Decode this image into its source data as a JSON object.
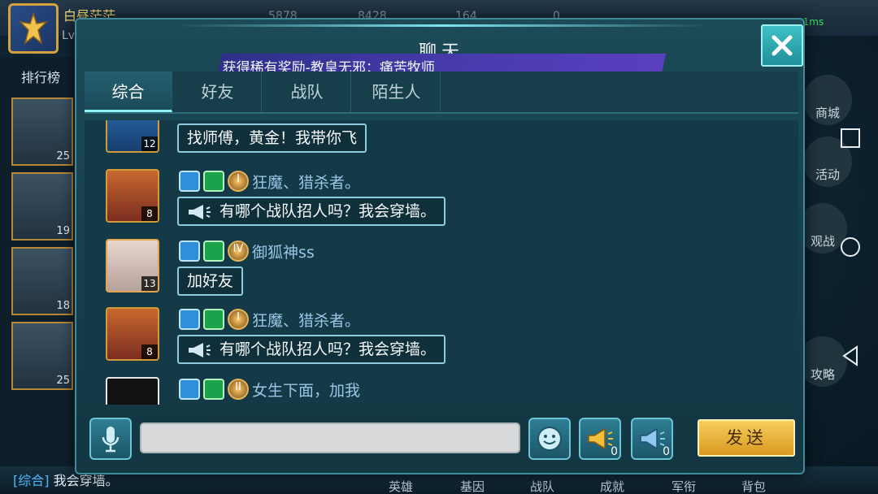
{
  "lobby": {
    "player_name": "白昼茫茫",
    "player_level": "Lv.21",
    "resources": [
      {
        "icon": "trophy-icon",
        "value": "5878"
      },
      {
        "icon": "gold-coin-icon",
        "value": "8428"
      },
      {
        "icon": "diamond-icon",
        "value": "164"
      },
      {
        "icon": "gem-icon",
        "value": "0"
      }
    ],
    "ping": "21ms",
    "leaderboard_label": "排行榜",
    "rank_cards": [
      {
        "level": "25"
      },
      {
        "level": "19"
      },
      {
        "level": "18"
      },
      {
        "level": "25"
      }
    ],
    "side_buttons": [
      "商城",
      "活动",
      "观战",
      "攻略"
    ],
    "bottom_nav": [
      "英雄",
      "基因",
      "战队",
      "成就",
      "军衔",
      "背包"
    ],
    "chat_ticker": {
      "channel": "[综合]",
      "text": "我会穿墙。"
    }
  },
  "chat": {
    "title": "聊天",
    "marquee": "获得稀有奖励-教皇无邪：痛苦牧师",
    "tabs": [
      {
        "label": "综合",
        "active": true
      },
      {
        "label": "好友",
        "active": false
      },
      {
        "label": "战队",
        "active": false
      },
      {
        "label": "陌生人",
        "active": false
      }
    ],
    "messages": [
      {
        "avatar": "knight",
        "level": "12",
        "sender": "",
        "rank": "",
        "text": "找师傅，黄金！我带你飞",
        "broadcast": false
      },
      {
        "avatar": "hero",
        "level": "8",
        "sender": "狂魔、猎杀者。",
        "rank": "I",
        "text": "有哪个战队招人吗？我会穿墙。",
        "broadcast": true
      },
      {
        "avatar": "wing",
        "level": "13",
        "sender": "御狐神ss",
        "rank": "IV",
        "text": "加好友",
        "broadcast": false
      },
      {
        "avatar": "hero",
        "level": "8",
        "sender": "狂魔、猎杀者。",
        "rank": "I",
        "text": "有哪个战队招人吗？我会穿墙。",
        "broadcast": true
      },
      {
        "avatar": "white",
        "level": "",
        "sender": "女生下面，加我",
        "rank": "II",
        "text": "",
        "broadcast": false
      }
    ],
    "input": {
      "value": "",
      "placeholder": ""
    },
    "horn_gold_count": "0",
    "horn_blue_count": "0",
    "send_label": "发送"
  }
}
